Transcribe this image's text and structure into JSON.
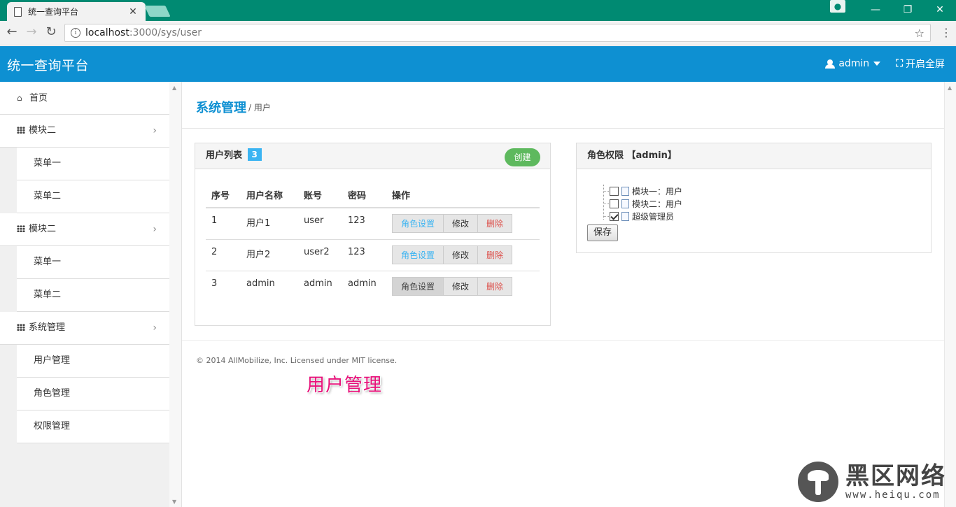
{
  "browser": {
    "tab_title": "统一查询平台",
    "tab_close": "✕",
    "url_host": "localhost",
    "url_path": ":3000/sys/user",
    "back_icon": "←",
    "forward_icon": "→",
    "reload_icon": "↻",
    "star_icon": "☆",
    "menu_icon": "⋮",
    "min_icon": "—",
    "restore_icon": "❐",
    "close_icon": "✕"
  },
  "header": {
    "brand": "统一查询平台",
    "user_label": "admin",
    "fullscreen_label": "开启全屏",
    "fullscreen_icon": "⛶"
  },
  "sidebar": {
    "items": [
      {
        "label": "首页",
        "icon": "⌂"
      },
      {
        "label": "模块二"
      },
      {
        "label": "菜单一"
      },
      {
        "label": "菜单二"
      },
      {
        "label": "模块二"
      },
      {
        "label": "菜单一"
      },
      {
        "label": "菜单二"
      },
      {
        "label": "系统管理"
      },
      {
        "label": "用户管理"
      },
      {
        "label": "角色管理"
      },
      {
        "label": "权限管理"
      }
    ],
    "chevron": "›"
  },
  "page": {
    "title": "系统管理",
    "crumb": "/ 用户"
  },
  "users_panel": {
    "title": "用户列表",
    "count": "3",
    "create_label": "创建",
    "columns": [
      "序号",
      "用户名称",
      "账号",
      "密码",
      "操作"
    ],
    "rows": [
      {
        "no": "1",
        "name": "用户1",
        "account": "user",
        "password": "123"
      },
      {
        "no": "2",
        "name": "用户2",
        "account": "user2",
        "password": "123"
      },
      {
        "no": "3",
        "name": "admin",
        "account": "admin",
        "password": "admin"
      }
    ],
    "action_role": "角色设置",
    "action_edit": "修改",
    "action_delete": "删除"
  },
  "role_panel": {
    "title": "角色权限 【admin】",
    "roles": [
      {
        "label": "模块一：用户",
        "checked": false
      },
      {
        "label": "模块二：用户",
        "checked": false
      },
      {
        "label": "超级管理员",
        "checked": true
      }
    ],
    "save_label": "保存"
  },
  "footer": {
    "copyright": "© 2014 AllMobilize, Inc. Licensed under MIT license."
  },
  "caption": "用户管理",
  "watermark": {
    "cn": "黑区网络",
    "en": "www.heiqu.com"
  },
  "colors": {
    "header_blue": "#0e90d2",
    "titlebar_green": "#008a72",
    "create_green": "#5eb95e",
    "badge_blue": "#3bb4f2",
    "delete_red": "#dd514c"
  }
}
